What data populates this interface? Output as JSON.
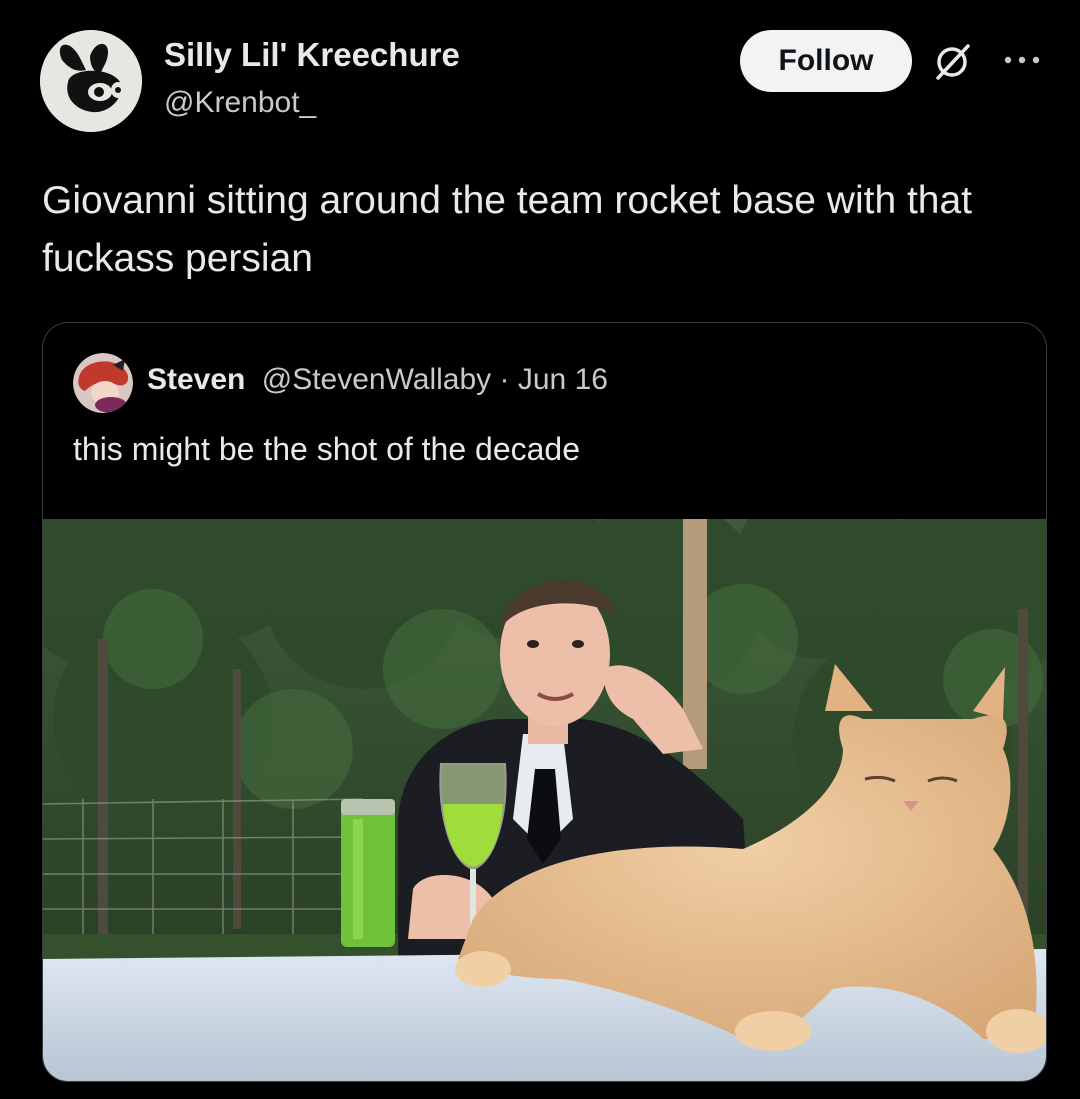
{
  "author": {
    "name": "Silly Lil' Kreechure",
    "handle": "@Krenbot_"
  },
  "actions": {
    "follow_label": "Follow"
  },
  "icons": {
    "grok": "grok-icon",
    "more": "more-icon"
  },
  "tweet": {
    "text": "Giovanni sitting around the team rocket base with that fuckass persian"
  },
  "quote": {
    "name": "Steven",
    "handle": "@StevenWallaby",
    "separator": "·",
    "date": "Jun 16",
    "text": "this might be the shot of the decade"
  },
  "colors": {
    "background": "#000000",
    "text": "#e7e9ea",
    "follow_bg": "#f3f3f3",
    "border": "#3a3d41"
  }
}
